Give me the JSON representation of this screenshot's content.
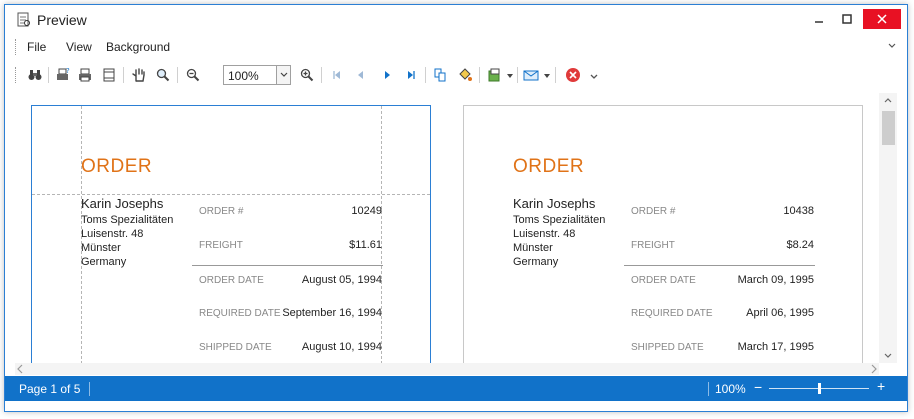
{
  "window": {
    "title": "Preview"
  },
  "menu": [
    "File",
    "View",
    "Background"
  ],
  "toolbar": {
    "zoom_value": "100%"
  },
  "pages": [
    {
      "title": "ORDER",
      "customer": {
        "name": "Karin Josephs",
        "company": "Toms Spezialitäten",
        "street": "Luisenstr. 48",
        "city": "Münster",
        "country": "Germany"
      },
      "fields": [
        {
          "label": "ORDER #",
          "value": "10249"
        },
        {
          "label": "FREIGHT",
          "value": "$11.61"
        },
        {
          "label": "ORDER DATE",
          "value": "August 05, 1994"
        },
        {
          "label": "REQUIRED DATE",
          "value": "September 16, 1994"
        },
        {
          "label": "SHIPPED DATE",
          "value": "August 10, 1994"
        }
      ]
    },
    {
      "title": "ORDER",
      "customer": {
        "name": "Karin Josephs",
        "company": "Toms Spezialitäten",
        "street": "Luisenstr. 48",
        "city": "Münster",
        "country": "Germany"
      },
      "fields": [
        {
          "label": "ORDER #",
          "value": "10438"
        },
        {
          "label": "FREIGHT",
          "value": "$8.24"
        },
        {
          "label": "ORDER DATE",
          "value": "March 09, 1995"
        },
        {
          "label": "REQUIRED DATE",
          "value": "April 06, 1995"
        },
        {
          "label": "SHIPPED DATE",
          "value": "March 17, 1995"
        }
      ]
    }
  ],
  "status": {
    "page": "Page 1 of 5",
    "zoom": "100%",
    "minus": "−",
    "plus": "+",
    "zoom_level": 0.5
  },
  "colors": {
    "accent": "#1172c9",
    "order_title": "#e07318",
    "close": "#e81123"
  }
}
